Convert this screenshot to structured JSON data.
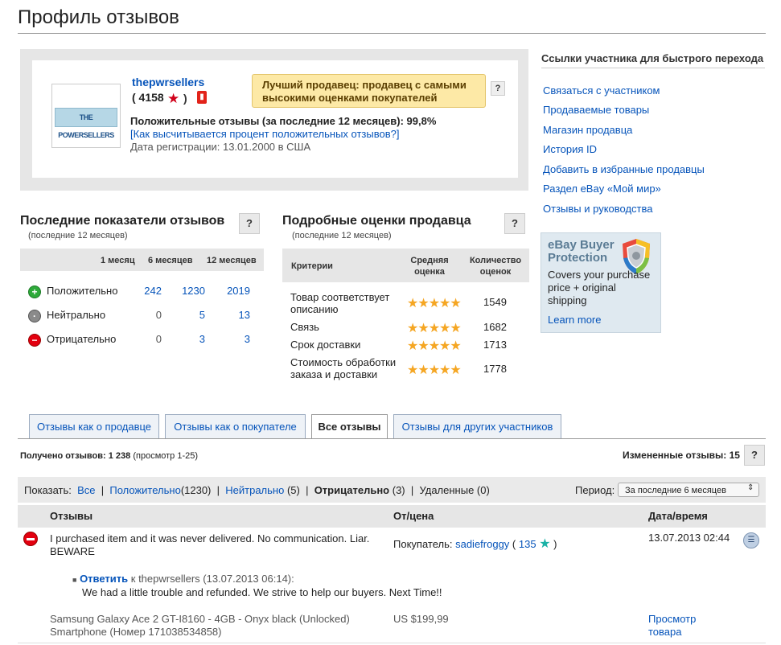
{
  "page": {
    "title": "Профиль отзывов"
  },
  "profile": {
    "username": "thepwrsellers",
    "score_open": "( 4158",
    "score_close": ")",
    "logo_text": "THE POWERSELLERS",
    "top_seller": "Лучший продавец: продавец с самыми высокими оценками покупателей",
    "help": "?",
    "positive_feedback": "Положительные отзывы (за последние 12 месяцев): 99,8%",
    "how_calculated": "[Как высчитывается процент положительных отзывов?]",
    "member_since": "Дата регистрации: 13.01.2000 в США"
  },
  "quick_links": {
    "title": "Ссылки участника для быстрого перехода",
    "items": [
      "Связаться с участником",
      "Продаваемые товары",
      "Магазин продавца",
      "История ID",
      "Добавить в избранные продавцы",
      "Раздел eBay «Мой мир»",
      "Отзывы и руководства"
    ]
  },
  "buyer_protection": {
    "title": "eBay Buyer Protection",
    "text": "Covers your purchase price + original shipping",
    "learn_more": "Learn more"
  },
  "recent_ratings": {
    "title": "Последние показатели отзывов",
    "subtitle": "(последние 12 месяцев)",
    "help": "?",
    "columns": [
      "1 месяц",
      "6 месяцев",
      "12 месяцев"
    ],
    "rows": [
      {
        "label": "Положительно",
        "icon": "+",
        "values": [
          "242",
          "1230",
          "2019"
        ],
        "color": "#2eaa3a"
      },
      {
        "label": "Нейтрально",
        "icon": "·",
        "values": [
          "0",
          "5",
          "13"
        ],
        "color": "#8a8a8a"
      },
      {
        "label": "Отрицательно",
        "icon": "−",
        "values": [
          "0",
          "3",
          "3"
        ],
        "color": "#e3000f"
      }
    ]
  },
  "detailed_ratings": {
    "title": "Подробные оценки продавца",
    "subtitle": "(последние 12 месяцев)",
    "help": "?",
    "columns": [
      "Критерии",
      "Средняя оценка",
      "Количество оценок"
    ],
    "rows": [
      {
        "criterion": "Товар соответствует описанию",
        "stars": "★★★★★",
        "count": "1549"
      },
      {
        "criterion": "Связь",
        "stars": "★★★★★",
        "count": "1682"
      },
      {
        "criterion": "Срок доставки",
        "stars": "★★★★★",
        "count": "1713"
      },
      {
        "criterion": "Стоимость обработки заказа и доставки",
        "stars": "★★★★★",
        "count": "1778"
      }
    ]
  },
  "tabs": [
    "Отзывы как о продавце",
    "Отзывы как о покупателе",
    "Все отзывы",
    "Отзывы для других участников"
  ],
  "feedback": {
    "received_label": "Получено отзывов: 1 238",
    "received_view": "(просмотр 1-25)",
    "changed": "Измененные отзывы: 15",
    "help": "?",
    "filter": {
      "show": "Показать:",
      "all": "Все",
      "positive": "Положительно",
      "positive_count": "(1230)",
      "neutral": "Нейтрально",
      "neutral_count": "(5)",
      "negative": "Отрицательно",
      "negative_count": "(3)",
      "removed": "Удаленные (0)",
      "sep": "|"
    },
    "period_label": "Период:",
    "period_value": "За последние 6 месяцев",
    "columns": [
      "Отзывы",
      "От/цена",
      "Дата/время"
    ],
    "entry": {
      "text": "I purchased item and it was never delivered. No communication. Liar. BEWARE",
      "from_label": "Покупатель:",
      "from_user": "sadiefroggy",
      "from_score": "135",
      "date": "13.07.2013 02:44",
      "reply_link": "Ответить",
      "reply_meta": "к thepwrsellers (13.07.2013 06:14):",
      "reply_text": "We had a little trouble and refunded. We strive to help our buyers. Next Time!!",
      "item": "Samsung Galaxy Ace 2 GT-I8160 - 4GB - Onyx black (Unlocked) Smartphone (Номер 171038534858)",
      "price": "US $199,99",
      "view_item": "Просмотр товара"
    }
  }
}
